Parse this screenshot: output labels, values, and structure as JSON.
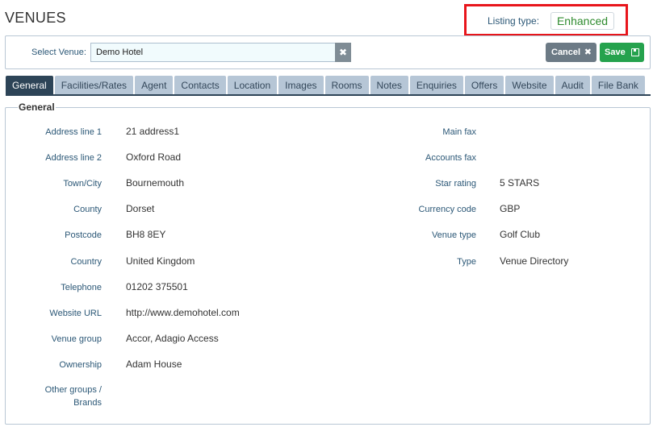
{
  "page": {
    "title": "VENUES"
  },
  "listing": {
    "label": "Listing type:",
    "value": "Enhanced"
  },
  "toolbar": {
    "select_label": "Select Venue:",
    "venue_value": "Demo Hotel",
    "clear_icon": "close-icon",
    "cancel_label": "Cancel",
    "cancel_icon": "close-icon",
    "save_label": "Save",
    "save_icon": "floppy-disk-icon"
  },
  "tabs": [
    {
      "label": "General",
      "active": true
    },
    {
      "label": "Facilities/Rates"
    },
    {
      "label": "Agent"
    },
    {
      "label": "Contacts"
    },
    {
      "label": "Location"
    },
    {
      "label": "Images"
    },
    {
      "label": "Rooms"
    },
    {
      "label": "Notes"
    },
    {
      "label": "Enquiries"
    },
    {
      "label": "Offers"
    },
    {
      "label": "Website"
    },
    {
      "label": "Audit"
    },
    {
      "label": "File Bank"
    }
  ],
  "general": {
    "legend": "General",
    "left": [
      {
        "label": "Address line 1",
        "value": "21 address1"
      },
      {
        "label": "Address line 2",
        "value": "Oxford Road"
      },
      {
        "label": "Town/City",
        "value": "Bournemouth"
      },
      {
        "label": "County",
        "value": "Dorset"
      },
      {
        "label": "Postcode",
        "value": "BH8 8EY"
      },
      {
        "label": "Country",
        "value": "United Kingdom"
      },
      {
        "label": "Telephone",
        "value": "01202 375501"
      },
      {
        "label": "Website URL",
        "value": "http://www.demohotel.com"
      },
      {
        "label": "Venue group",
        "value": "Accor, Adagio Access"
      },
      {
        "label": "Ownership",
        "value": "Adam House"
      },
      {
        "label": "Other groups / Brands",
        "value": ""
      }
    ],
    "right": [
      {
        "label": "Main fax",
        "value": ""
      },
      {
        "label": "Accounts fax",
        "value": ""
      },
      {
        "label": "Star rating",
        "value": "5 STARS"
      },
      {
        "label": "Currency code",
        "value": "GBP"
      },
      {
        "label": "Venue type",
        "value": "Golf Club"
      },
      {
        "label": "Type",
        "value": "Venue Directory"
      }
    ]
  },
  "colors": {
    "accent_dark": "#2d4457",
    "tab_inactive": "#b6c6d6",
    "save_green": "#25a24d",
    "highlight_red": "#e8151b",
    "enhanced_green": "#2e8b2e"
  }
}
